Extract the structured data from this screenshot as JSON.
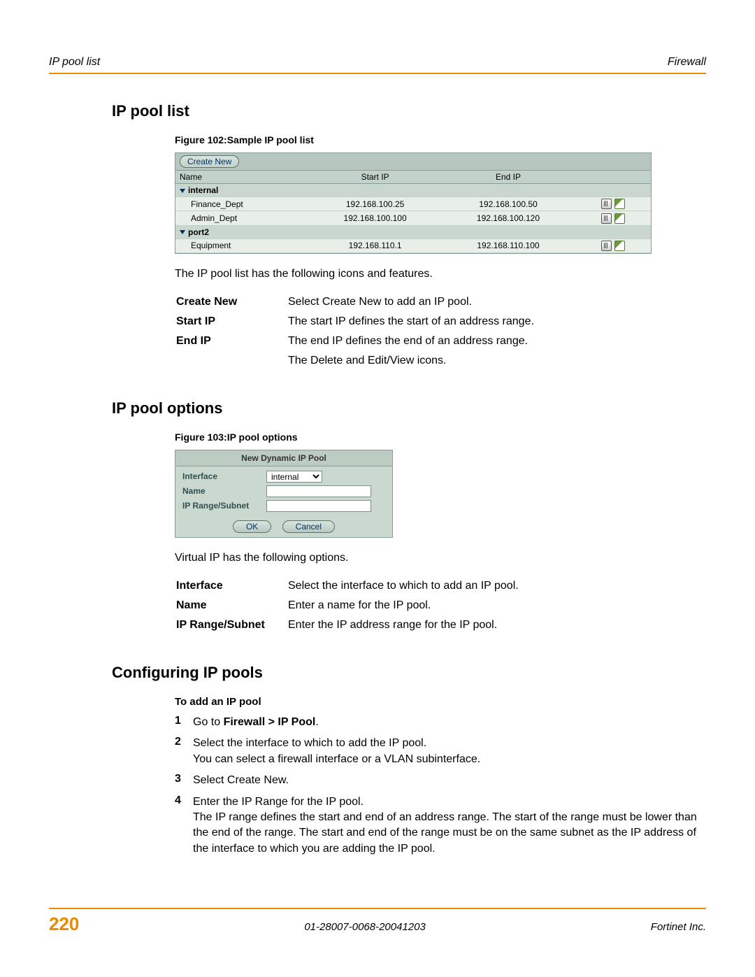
{
  "header": {
    "left": "IP pool list",
    "right": "Firewall"
  },
  "section1": {
    "title": "IP pool list",
    "figure_caption": "Figure 102:Sample IP pool list",
    "create_new_label": "Create New",
    "columns": {
      "name": "Name",
      "start_ip": "Start IP",
      "end_ip": "End IP"
    },
    "groups": [
      {
        "name": "internal",
        "rows": [
          {
            "name": "Finance_Dept",
            "start_ip": "192.168.100.25",
            "end_ip": "192.168.100.50"
          },
          {
            "name": "Admin_Dept",
            "start_ip": "192.168.100.100",
            "end_ip": "192.168.100.120"
          }
        ]
      },
      {
        "name": "port2",
        "rows": [
          {
            "name": "Equipment",
            "start_ip": "192.168.110.1",
            "end_ip": "192.168.110.100"
          }
        ]
      }
    ],
    "intro": "The IP pool list has the following icons and features.",
    "features": [
      {
        "label": "Create New",
        "desc": "Select Create New to add an IP pool."
      },
      {
        "label": "Start IP",
        "desc": "The start IP defines the start of an address range."
      },
      {
        "label": "End IP",
        "desc": "The end IP defines the end of an address range."
      },
      {
        "label": "",
        "desc": "The Delete and Edit/View icons."
      }
    ]
  },
  "section2": {
    "title": "IP pool options",
    "figure_caption": "Figure 103:IP pool options",
    "dialog": {
      "title": "New Dynamic IP Pool",
      "fields": {
        "interface_label": "Interface",
        "interface_value": "internal",
        "name_label": "Name",
        "name_value": "",
        "iprange_label": "IP Range/Subnet",
        "iprange_value": ""
      },
      "ok": "OK",
      "cancel": "Cancel"
    },
    "intro": "Virtual IP has the following options.",
    "features": [
      {
        "label": "Interface",
        "desc": "Select the interface to which to add an IP pool."
      },
      {
        "label": "Name",
        "desc": "Enter a name for the IP pool."
      },
      {
        "label": "IP Range/Subnet",
        "desc": "Enter the IP address range for the IP pool."
      }
    ]
  },
  "section3": {
    "title": "Configuring IP pools",
    "subtitle": "To add an IP pool",
    "steps": [
      {
        "num": "1",
        "html": "Go to <b>Firewall > IP Pool</b>."
      },
      {
        "num": "2",
        "html": "Select the interface to which to add the IP pool.<br>You can select a firewall interface or a VLAN subinterface."
      },
      {
        "num": "3",
        "html": "Select Create New."
      },
      {
        "num": "4",
        "html": "Enter the IP Range for the IP pool.<br>The IP range defines the start and end of an address range. The start of the range must be lower than the end of the range. The start and end of the range must be on the same subnet as the IP address of the interface to which you are adding the IP pool."
      }
    ]
  },
  "footer": {
    "page": "220",
    "docid": "01-28007-0068-20041203",
    "company": "Fortinet Inc."
  }
}
